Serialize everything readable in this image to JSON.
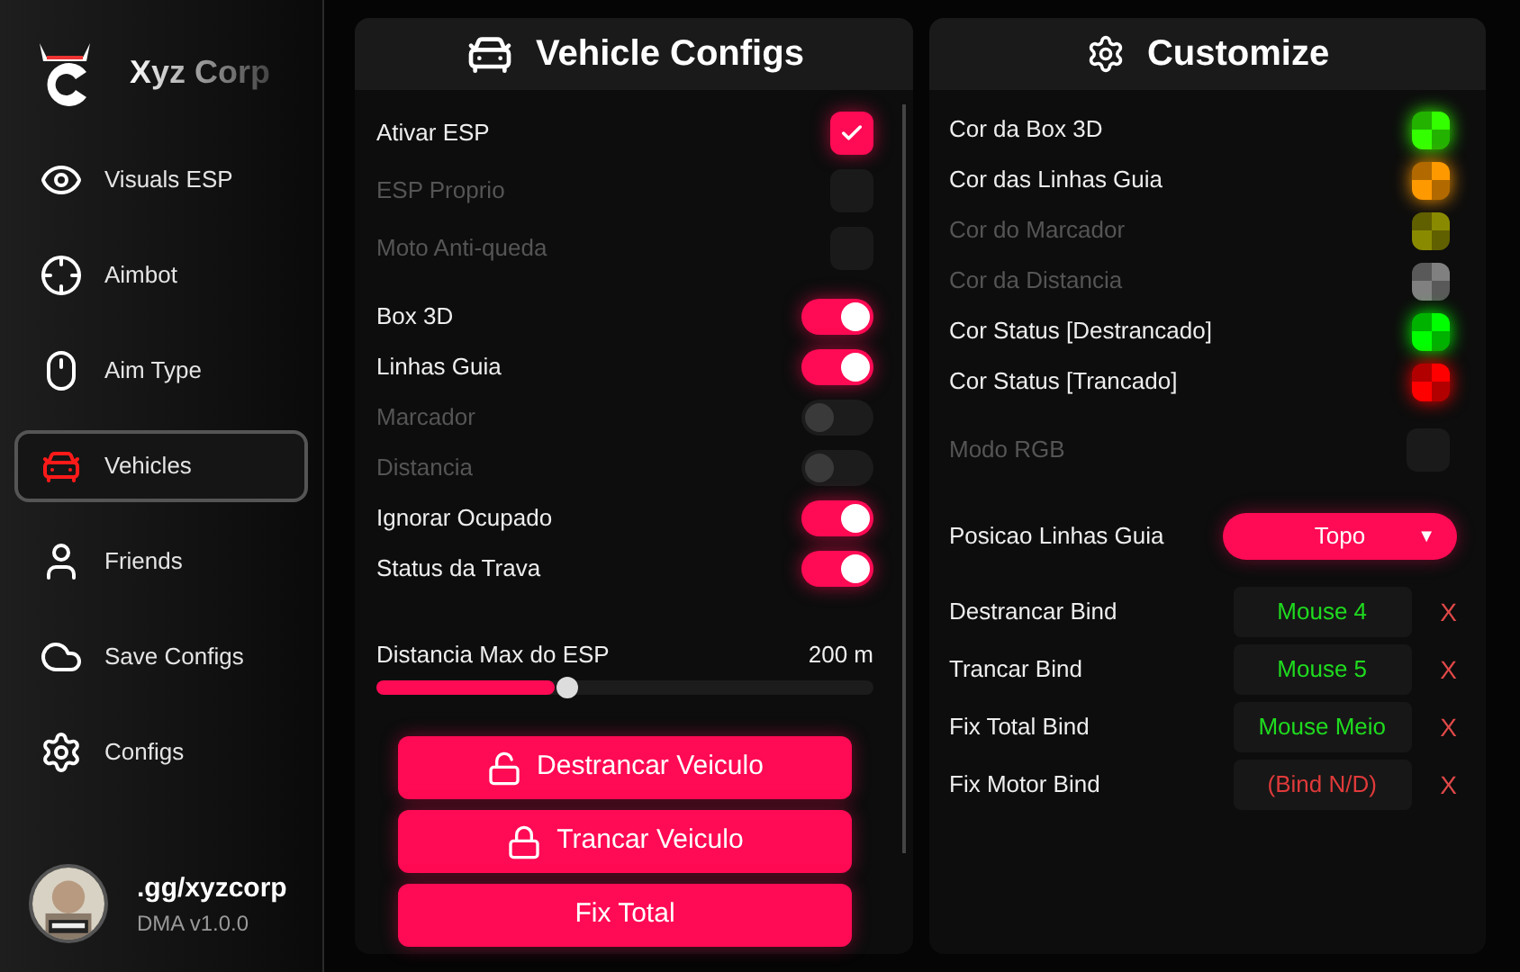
{
  "brand": {
    "name": "Xyz Corp"
  },
  "nav": [
    {
      "label": "Visuals ESP",
      "kind": "eye",
      "selected": false
    },
    {
      "label": "Aimbot",
      "kind": "target",
      "selected": false
    },
    {
      "label": "Aim Type",
      "kind": "mouse",
      "selected": false
    },
    {
      "label": "Vehicles",
      "kind": "car",
      "selected": true
    },
    {
      "label": "Friends",
      "kind": "user",
      "selected": false
    },
    {
      "label": "Save Configs",
      "kind": "cloud",
      "selected": false
    },
    {
      "label": "Configs",
      "kind": "gear",
      "selected": false
    }
  ],
  "profile": {
    "handle": ".gg/xyzcorp",
    "version": "DMA v1.0.0"
  },
  "vehicle_panel": {
    "title": "Vehicle Configs",
    "options": [
      {
        "kind": "checkbox",
        "label": "Ativar ESP",
        "checked": true,
        "disabled": false
      },
      {
        "kind": "checkbox",
        "label": "ESP Proprio",
        "checked": false,
        "disabled": true
      },
      {
        "kind": "checkbox",
        "label": "Moto Anti-queda",
        "checked": false,
        "disabled": true
      },
      {
        "kind": "toggle",
        "label": "Box 3D",
        "checked": true,
        "disabled": false
      },
      {
        "kind": "toggle",
        "label": "Linhas Guia",
        "checked": true,
        "disabled": false
      },
      {
        "kind": "toggle",
        "label": "Marcador",
        "checked": false,
        "disabled": true
      },
      {
        "kind": "toggle",
        "label": "Distancia",
        "checked": false,
        "disabled": true
      },
      {
        "kind": "toggle",
        "label": "Ignorar Ocupado",
        "checked": true,
        "disabled": false
      },
      {
        "kind": "toggle",
        "label": "Status da Trava",
        "checked": true,
        "disabled": false
      }
    ],
    "slider": {
      "label": "Distancia Max do ESP",
      "reading": "200 m",
      "level": 0.36
    },
    "buttons": [
      {
        "label": "Destrancar Veiculo",
        "kind": "unlock"
      },
      {
        "label": "Trancar Veiculo",
        "kind": "lock"
      },
      {
        "label": "Fix Total",
        "kind": "plain"
      }
    ]
  },
  "customize_panel": {
    "title": "Customize",
    "colors": [
      {
        "label": "Cor da Box 3D",
        "color": "#33ff00",
        "disabled": false
      },
      {
        "label": "Cor das Linhas Guia",
        "color": "#ff9900",
        "disabled": false
      },
      {
        "label": "Cor do Marcador",
        "color": "#8a8a00",
        "disabled": true
      },
      {
        "label": "Cor da Distancia",
        "color": "#808080",
        "disabled": true
      },
      {
        "label": "Cor Status [Destrancado]",
        "color": "#00ff00",
        "disabled": false
      },
      {
        "label": "Cor Status [Trancado]",
        "color": "#ff0000",
        "disabled": false
      }
    ],
    "rgb_mode": {
      "label": "Modo RGB",
      "checked": false,
      "disabled": true
    },
    "guide_position": {
      "label": "Posicao Linhas Guia",
      "value": "Topo",
      "arrow": "▼"
    },
    "binds": [
      {
        "label": "Destrancar Bind",
        "value": "Mouse 4",
        "assigned": true,
        "clear": "X"
      },
      {
        "label": "Trancar Bind",
        "value": "Mouse 5",
        "assigned": true,
        "clear": "X"
      },
      {
        "label": "Fix Total Bind",
        "value": "Mouse Meio",
        "assigned": true,
        "clear": "X"
      },
      {
        "label": "Fix Motor Bind",
        "value": "(Bind N/D)",
        "assigned": false,
        "clear": "X"
      }
    ]
  }
}
